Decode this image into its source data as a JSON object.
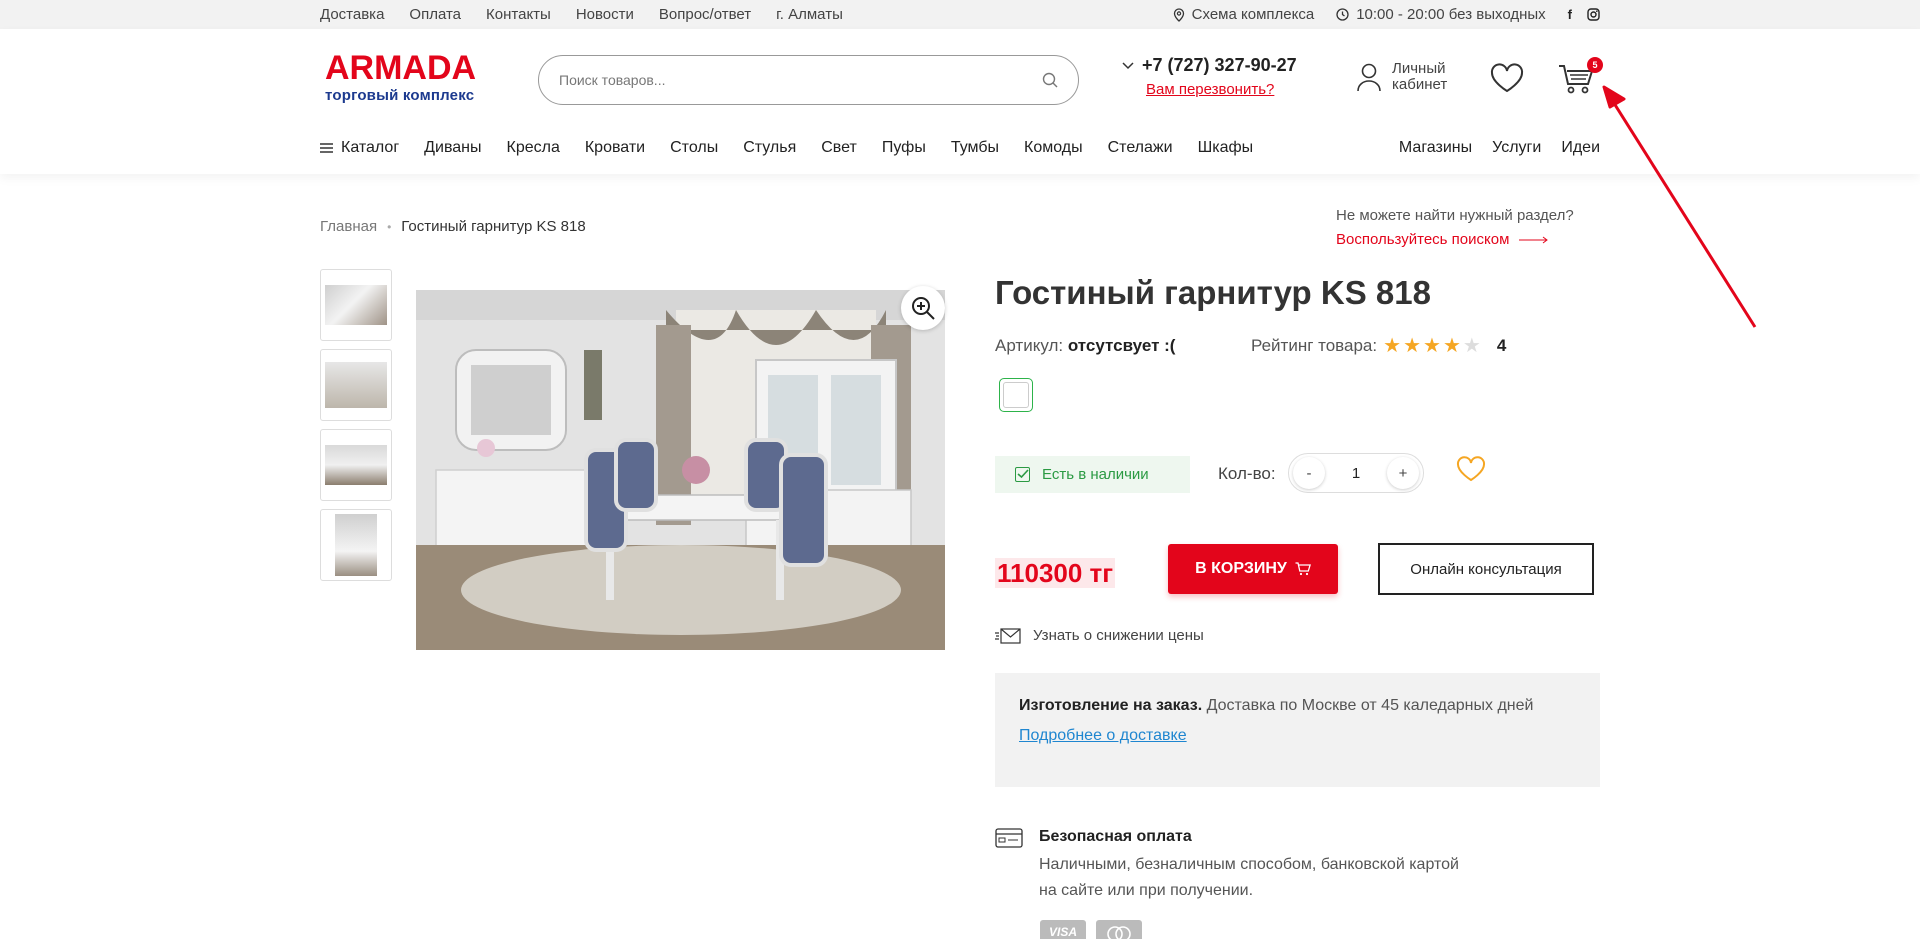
{
  "topbar": {
    "links": [
      "Доставка",
      "Оплата",
      "Контакты",
      "Новости",
      "Вопрос/ответ",
      "г. Алматы"
    ],
    "scheme": "Схема комплекса",
    "hours": "10:00 - 20:00 без выходных",
    "social": {
      "facebook": "f",
      "instagram_icon": "instagram-icon"
    }
  },
  "header": {
    "logo_brand": "ARMADA",
    "logo_sub": "торговый комплекс",
    "search_placeholder": "Поиск товаров...",
    "phone": "+7 (727) 327-90-27",
    "callback": "Вам перезвонить?",
    "account_line1": "Личный",
    "account_line2": "кабинет",
    "cart_count": "5"
  },
  "nav": {
    "catalog": "Каталог",
    "items": [
      "Диваны",
      "Кресла",
      "Кровати",
      "Столы",
      "Стулья",
      "Свет",
      "Пуфы",
      "Тумбы",
      "Комоды",
      "Стелажи",
      "Шкафы"
    ],
    "right": [
      "Магазины",
      "Услуги",
      "Идеи"
    ]
  },
  "breadcrumb": {
    "home": "Главная",
    "current": "Гостиный гарнитур KS 818"
  },
  "search_hint": {
    "question": "Не можете найти нужный раздел?",
    "link": "Воспользуйтесь поиском"
  },
  "product": {
    "title": "Гостиный гарнитур KS 818",
    "article_label": "Артикул:",
    "article_value": "отсутсвует :(",
    "rating_label": "Рейтинг товара:",
    "rating_value": "4",
    "rating_stars": 4,
    "in_stock": "Есть в наличии",
    "qty_label": "Кол-во:",
    "qty_minus": "-",
    "qty_value": "1",
    "qty_plus": "+",
    "price": "110300 тг",
    "to_cart": "В КОРЗИНУ",
    "consult": "Онлайн консультация",
    "notify": "Узнать о снижении цены"
  },
  "delivery": {
    "bold": "Изготовление на заказ.",
    "text": "Доставка по Москве от 45 каледарных дней",
    "more": "Подробнее о доставке"
  },
  "payment": {
    "title": "Безопасная оплата",
    "text": "Наличными, безналичным способом, банковской картой на сайте или при получении.",
    "cards": [
      "VISA",
      "mastercard-icon"
    ]
  },
  "colors": {
    "accent": "#e3051b",
    "brand_blue": "#1c3a8f",
    "green": "#2b9a43",
    "star": "#f5a623",
    "link_blue": "#1f86d0"
  }
}
